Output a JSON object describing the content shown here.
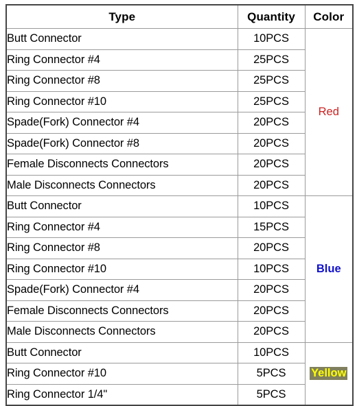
{
  "table": {
    "columns": [
      {
        "key": "type",
        "label": "Type"
      },
      {
        "key": "quantity",
        "label": "Quantity"
      },
      {
        "key": "color",
        "label": "Color"
      }
    ],
    "groups": [
      {
        "color_label": "Red",
        "color_hex": "#cc2222",
        "color_style": "plain",
        "rows": [
          {
            "type": "Butt Connector",
            "quantity": "10PCS"
          },
          {
            "type": "Ring Connector #4",
            "quantity": "25PCS"
          },
          {
            "type": "Ring Connector #8",
            "quantity": "25PCS"
          },
          {
            "type": "Ring Connector #10",
            "quantity": "25PCS"
          },
          {
            "type": "Spade(Fork) Connector #4",
            "quantity": "20PCS"
          },
          {
            "type": "Spade(Fork) Connector #8",
            "quantity": "20PCS"
          },
          {
            "type": "Female Disconnects Connectors",
            "quantity": "20PCS"
          },
          {
            "type": "Male Disconnects Connectors",
            "quantity": "20PCS"
          }
        ]
      },
      {
        "color_label": "Blue",
        "color_hex": "#1111cc",
        "color_style": "bold",
        "rows": [
          {
            "type": "Butt Connector",
            "quantity": "10PCS"
          },
          {
            "type": "Ring Connector #4",
            "quantity": "15PCS"
          },
          {
            "type": "Ring Connector #8",
            "quantity": "20PCS"
          },
          {
            "type": "Ring Connector #10",
            "quantity": "10PCS"
          },
          {
            "type": "Spade(Fork) Connector #4",
            "quantity": "20PCS"
          },
          {
            "type": "Female Disconnects Connectors",
            "quantity": "20PCS"
          },
          {
            "type": "Male Disconnects Connectors",
            "quantity": "20PCS"
          }
        ]
      },
      {
        "color_label": "Yellow",
        "color_hex": "#ffff00",
        "color_highlight_hex": "#80805e",
        "color_style": "highlight",
        "rows": [
          {
            "type": "Butt Connector",
            "quantity": "10PCS"
          },
          {
            "type": "Ring Connector #10",
            "quantity": "5PCS"
          },
          {
            "type": "Ring Connector 1/4\"",
            "quantity": "5PCS"
          }
        ]
      }
    ]
  }
}
